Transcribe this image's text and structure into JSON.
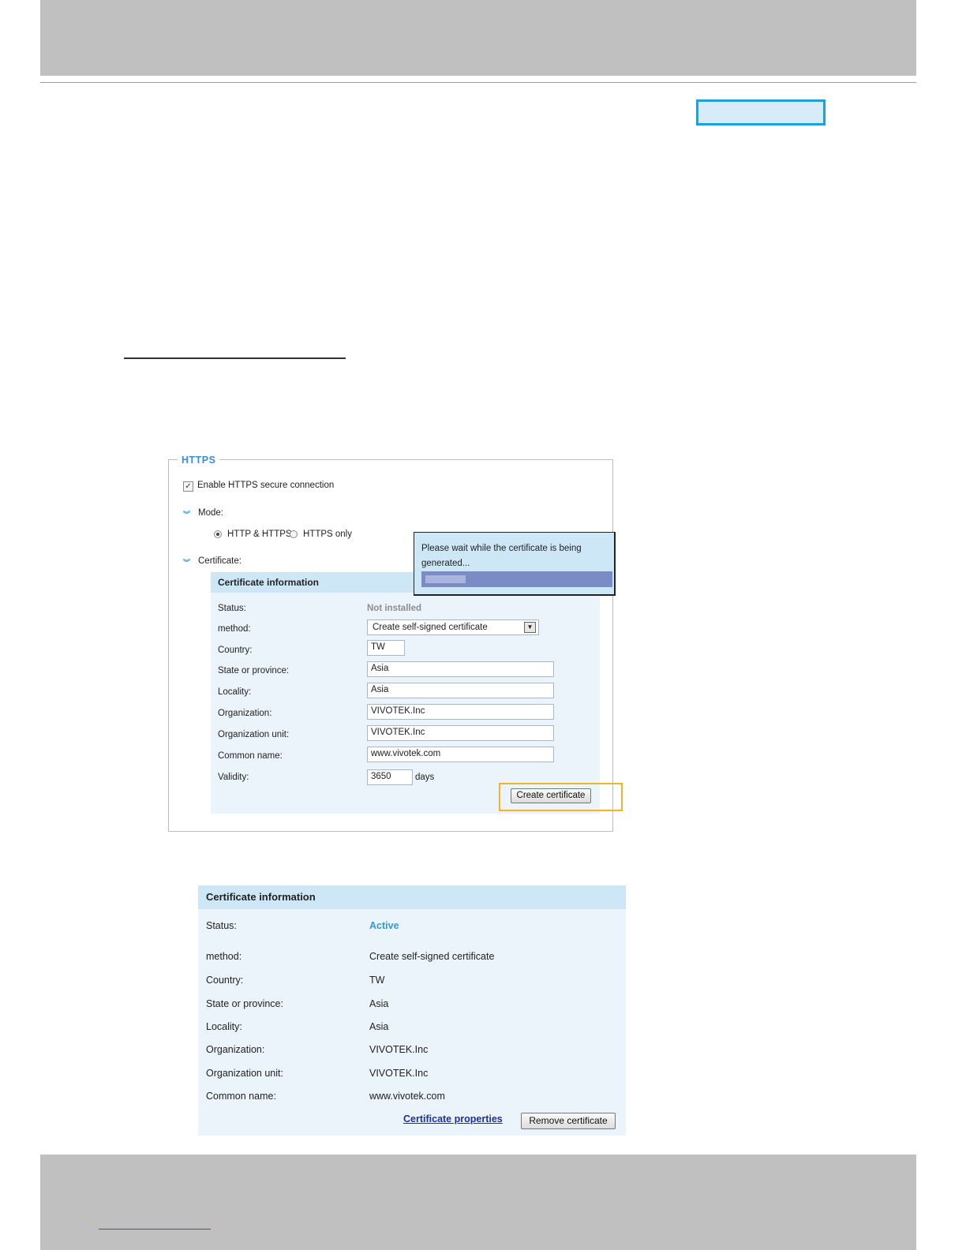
{
  "https": {
    "legend": "HTTPS",
    "enable_label": "Enable HTTPS secure connection",
    "enable_checked": true,
    "mode_label": "Mode:",
    "mode_options": [
      "HTTP & HTTPS",
      "HTTPS only"
    ],
    "mode_selected": "HTTP & HTTPS",
    "certificate_label": "Certificate:"
  },
  "cert_form": {
    "title": "Certificate information",
    "status_label": "Status:",
    "status_value": "Not installed",
    "method_label": "method:",
    "method_value": "Create self-signed certificate",
    "country_label": "Country:",
    "country_value": "TW",
    "state_label": "State or province:",
    "state_value": "Asia",
    "locality_label": "Locality:",
    "locality_value": "Asia",
    "org_label": "Organization:",
    "org_value": "VIVOTEK.Inc",
    "orgunit_label": "Organization unit:",
    "orgunit_value": "VIVOTEK.Inc",
    "common_label": "Common name:",
    "common_value": "www.vivotek.com",
    "validity_label": "Validity:",
    "validity_value": "3650",
    "validity_unit": "days",
    "create_button": "Create certificate"
  },
  "popup": {
    "message": "Please wait while the certificate is being generated...",
    "progress": 0.22
  },
  "cert_info": {
    "title": "Certificate information",
    "rows": [
      {
        "label": "Status:",
        "value": "Active"
      },
      {
        "label": "method:",
        "value": "Create self-signed certificate"
      },
      {
        "label": "Country:",
        "value": "TW"
      },
      {
        "label": "State or province:",
        "value": "Asia"
      },
      {
        "label": "Locality:",
        "value": "Asia"
      },
      {
        "label": "Organization:",
        "value": "VIVOTEK.Inc"
      },
      {
        "label": "Organization unit:",
        "value": "VIVOTEK.Inc"
      },
      {
        "label": "Common name:",
        "value": "www.vivotek.com"
      }
    ],
    "properties_link": "Certificate properties",
    "remove_button": "Remove certificate"
  },
  "colors": {
    "accent": "#2f9ad8",
    "panel": "#eaf4fa",
    "panel_header": "#cde7f7",
    "highlight": "#f0b429"
  }
}
